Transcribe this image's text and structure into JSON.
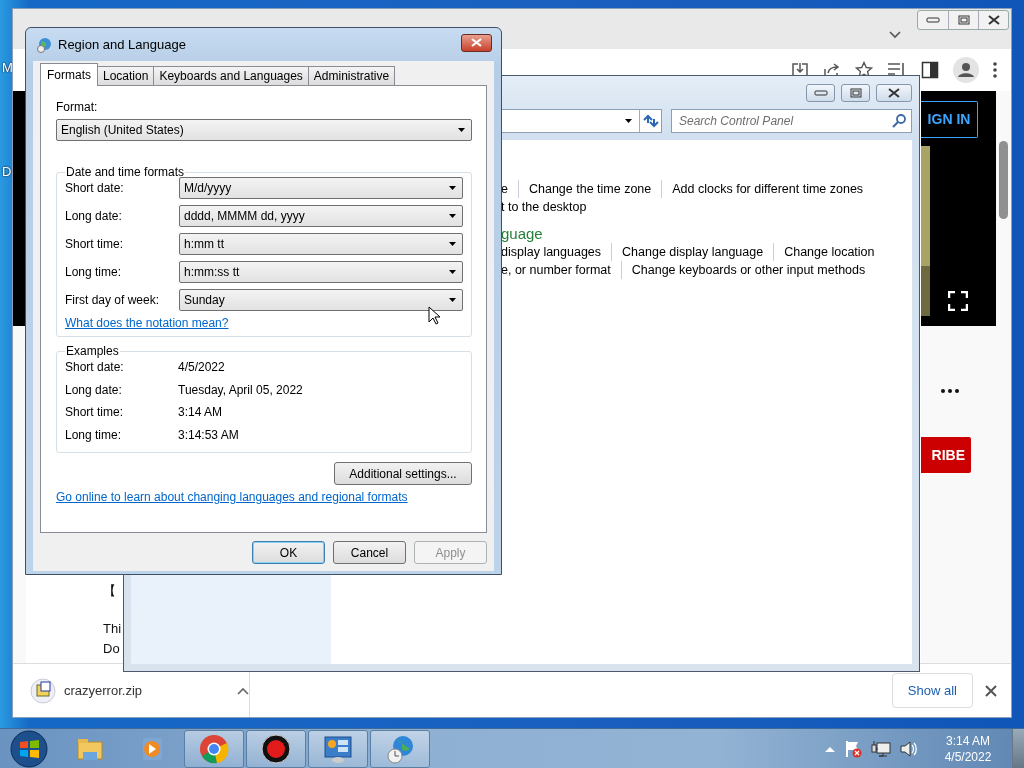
{
  "desktop": {
    "icon_labels": [
      "M",
      "D"
    ]
  },
  "browser": {
    "page": {
      "sign_in": "IGN IN",
      "subscribe": "RIBE",
      "text_lines": [
        "【",
        "Thi",
        "Do"
      ]
    },
    "downloads": {
      "items": [
        {
          "file": "crazyerror.zip"
        }
      ],
      "show_all": "Show all"
    }
  },
  "control_panel": {
    "search": {
      "placeholder": "Search Control Panel"
    },
    "lines": [
      {
        "kind": "links",
        "items": [
          "e",
          "Change the time zone",
          "Add clocks for different time zones"
        ]
      },
      {
        "kind": "links",
        "items": [
          "t to the desktop"
        ]
      },
      {
        "kind": "heading",
        "text": "guage"
      },
      {
        "kind": "links",
        "items": [
          "display languages",
          "Change display language",
          "Change location"
        ]
      },
      {
        "kind": "links",
        "items": [
          "e, or number format",
          "Change keyboards or other input methods"
        ]
      }
    ]
  },
  "dialog": {
    "title": "Region and Language",
    "tabs": [
      {
        "label": "Formats",
        "selected": true
      },
      {
        "label": "Location",
        "selected": false
      },
      {
        "label": "Keyboards and Languages",
        "selected": false
      },
      {
        "label": "Administrative",
        "selected": false
      }
    ],
    "format": {
      "label": "Format:",
      "value": "English (United States)"
    },
    "date_time_formats": {
      "title": "Date and time formats",
      "rows": [
        {
          "label": "Short date:",
          "value": "M/d/yyyy"
        },
        {
          "label": "Long date:",
          "value": "dddd, MMMM dd, yyyy"
        },
        {
          "label": "Short time:",
          "value": "h:mm tt"
        },
        {
          "label": "Long time:",
          "value": "h:mm:ss tt"
        },
        {
          "label": "First day of week:",
          "value": "Sunday"
        }
      ],
      "notation_link": "What does the notation mean?"
    },
    "examples": {
      "title": "Examples",
      "rows": [
        {
          "label": "Short date:",
          "value": "4/5/2022"
        },
        {
          "label": "Long date:",
          "value": "Tuesday, April 05, 2022"
        },
        {
          "label": "Short time:",
          "value": "3:14 AM"
        },
        {
          "label": "Long time:",
          "value": "3:14:53 AM"
        }
      ]
    },
    "additional_settings": "Additional settings...",
    "online_link": "Go online to learn about changing languages and regional formats",
    "buttons": [
      {
        "label": "OK",
        "default": true,
        "disabled": false
      },
      {
        "label": "Cancel",
        "default": false,
        "disabled": false
      },
      {
        "label": "Apply",
        "default": false,
        "disabled": true
      }
    ]
  },
  "taskbar": {
    "apps": [
      {
        "kind": "explorer",
        "running": false
      },
      {
        "kind": "media",
        "running": false
      },
      {
        "kind": "chrome",
        "running": true
      },
      {
        "kind": "recorder",
        "running": true
      },
      {
        "kind": "control-panel",
        "running": true
      },
      {
        "kind": "region",
        "running": true
      }
    ],
    "clock": {
      "time": "3:14 AM",
      "date": "4/5/2022"
    }
  }
}
